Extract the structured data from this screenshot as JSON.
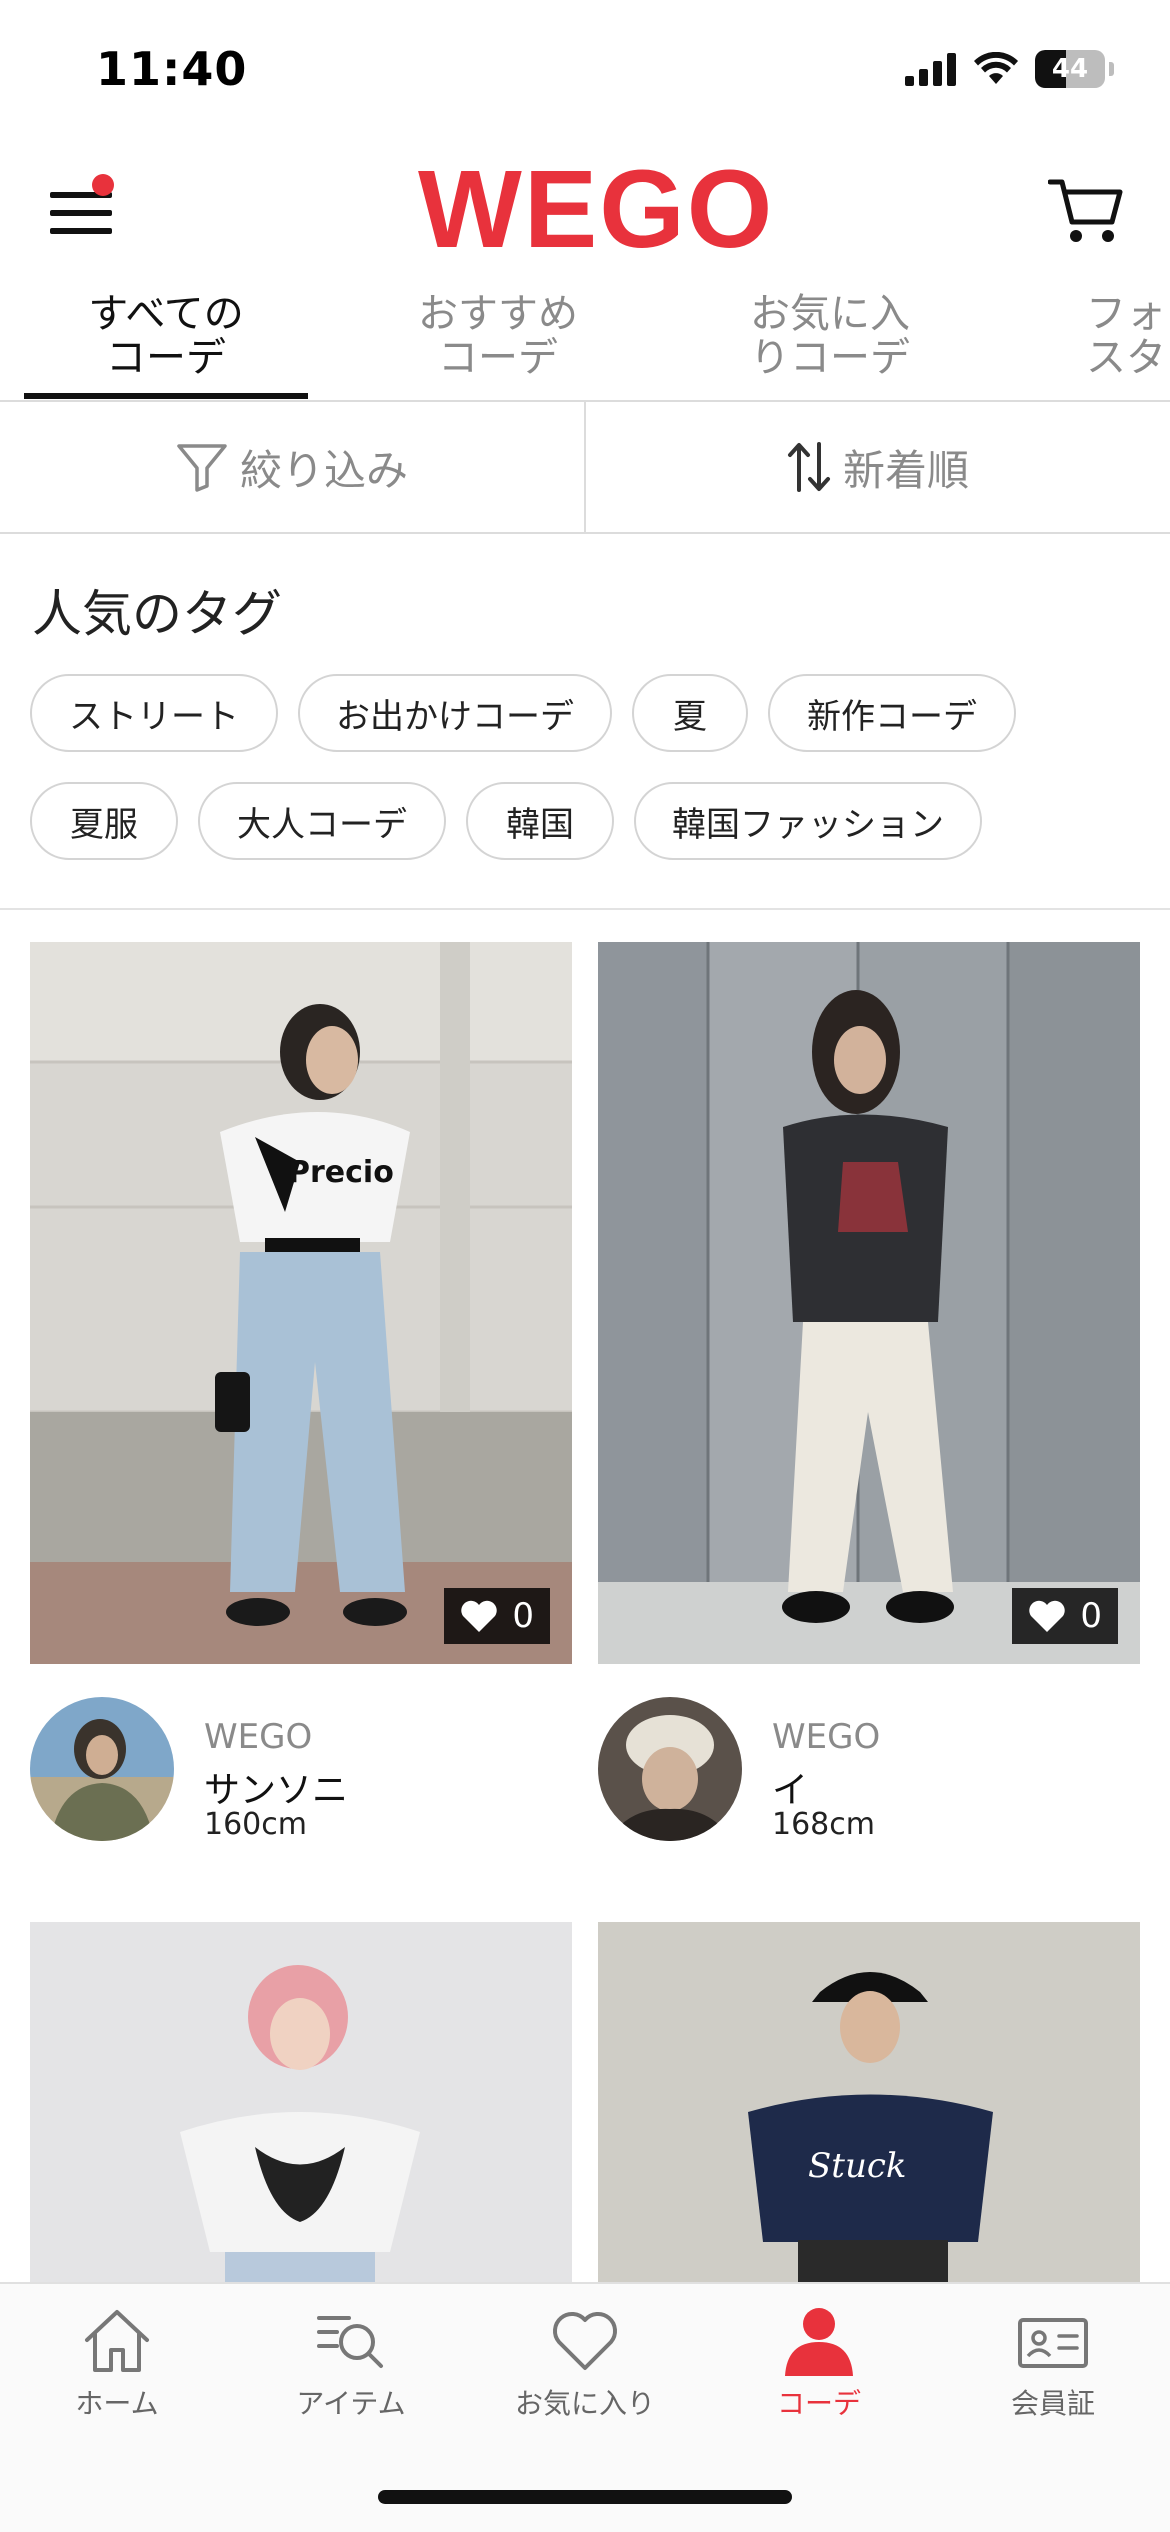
{
  "status_bar": {
    "time": "11:40",
    "battery_level": "44",
    "battery_fraction": 0.44
  },
  "header": {
    "logo_text": "WEGO",
    "brand_color": "#e8323c",
    "menu_has_notification": true
  },
  "tabs": [
    {
      "label_line1": "すべての",
      "label_line2": "コーデ",
      "active": true
    },
    {
      "label_line1": "おすすめ",
      "label_line2": "コーデ",
      "active": false
    },
    {
      "label_line1": "お気に入",
      "label_line2": "りコーデ",
      "active": false
    },
    {
      "label_line1": "フォ",
      "label_line2": "スタ",
      "active": false
    }
  ],
  "toolbar": {
    "filter_label": "絞り込み",
    "sort_label": "新着順"
  },
  "tags": {
    "title": "人気のタグ",
    "row1": [
      "ストリート",
      "お出かけコーデ",
      "夏",
      "新作コーデ"
    ],
    "row2": [
      "夏服",
      "大人コーデ",
      "韓国",
      "韓国ファッション"
    ]
  },
  "posts": [
    {
      "likes": "0",
      "brand": "WEGO",
      "name": "サンソニ",
      "height": "160cm"
    },
    {
      "likes": "0",
      "brand": "WEGO",
      "name": "イ",
      "height": "168cm"
    },
    {
      "likes": "",
      "brand": "",
      "name": "",
      "height": ""
    },
    {
      "likes": "",
      "brand": "",
      "name": "",
      "height": ""
    }
  ],
  "bottom_nav": {
    "home": "ホーム",
    "items": "アイテム",
    "favorites": "お気に入り",
    "coordinate": "コーデ",
    "member_card": "会員証",
    "active": "coordinate",
    "active_color": "#e8323c"
  }
}
